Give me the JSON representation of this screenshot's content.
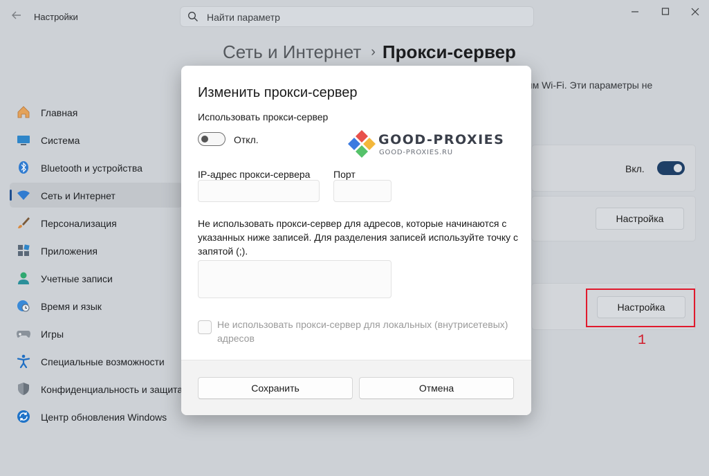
{
  "window": {
    "app_title": "Настройки",
    "search_placeholder": "Найти параметр",
    "breadcrumb": {
      "parent": "Сеть и Интернет",
      "separator": "›",
      "current": "Прокси-сервер"
    },
    "background_description": "ям Wi-Fi. Эти параметры не"
  },
  "sidebar": {
    "items": [
      {
        "label": "Главная",
        "icon": "home-icon"
      },
      {
        "label": "Система",
        "icon": "monitor-icon"
      },
      {
        "label": "Bluetooth и устройства",
        "icon": "bluetooth-icon"
      },
      {
        "label": "Сеть и Интернет",
        "icon": "wifi-icon",
        "active": true
      },
      {
        "label": "Персонализация",
        "icon": "brush-icon"
      },
      {
        "label": "Приложения",
        "icon": "apps-icon"
      },
      {
        "label": "Учетные записи",
        "icon": "user-icon"
      },
      {
        "label": "Время и язык",
        "icon": "clock-globe-icon"
      },
      {
        "label": "Игры",
        "icon": "gamepad-icon"
      },
      {
        "label": "Специальные возможности",
        "icon": "accessibility-icon"
      },
      {
        "label": "Конфиденциальность и защита",
        "icon": "shield-icon"
      },
      {
        "label": "Центр обновления Windows",
        "icon": "update-icon"
      }
    ]
  },
  "background_settings": {
    "auto_detect_toggle_label": "Вкл.",
    "auto_detect_toggle_on": true,
    "script_setup_button": "Настройка",
    "manual_setup_button": "Настройка",
    "callout_number": "1",
    "callout_color": "#e0192d"
  },
  "dialog": {
    "title": "Изменить прокси-сервер",
    "use_proxy_label": "Использовать прокси-сервер",
    "use_proxy_state": "Откл.",
    "use_proxy_on": false,
    "logo": {
      "wordmark": "GOOD-PROXIES",
      "domain": "GOOD-PROXIES.RU"
    },
    "ip_label": "IP-адрес прокси-сервера",
    "ip_value": "",
    "port_label": "Порт",
    "port_value": "",
    "exceptions_description": "Не использовать прокси-сервер для адресов, которые начинаются с указанных ниже записей. Для разделения записей используйте точку с запятой (;).",
    "exceptions_value": "",
    "local_checkbox_label": "Не использовать прокси-сервер для локальных (внутрисетевых) адресов",
    "local_checkbox_checked": false,
    "save_button": "Сохранить",
    "cancel_button": "Отмена"
  },
  "colors": {
    "accent": "#1e3f66",
    "logo_red": "#e8504a",
    "logo_blue": "#3b7be0",
    "logo_green": "#55c26a",
    "logo_yellow": "#f3b73b"
  }
}
